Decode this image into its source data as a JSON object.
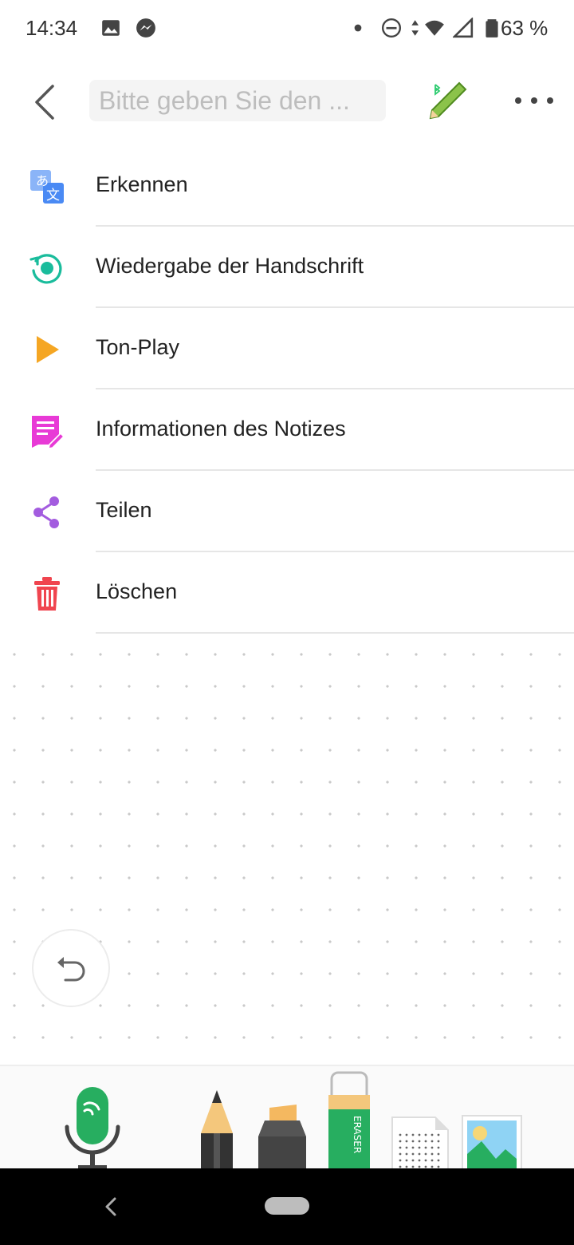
{
  "status_bar": {
    "time": "14:34",
    "battery": "63 %",
    "icons": [
      "image-icon",
      "messenger-icon",
      "dot-icon",
      "dnd-icon",
      "data-arrows-icon",
      "wifi-icon",
      "signal-icon",
      "battery-icon"
    ]
  },
  "appbar": {
    "search_placeholder": "Bitte geben Sie den ..."
  },
  "menu": {
    "items": [
      {
        "label": "Erkennen",
        "icon": "translate-icon",
        "color": "#4a8af4"
      },
      {
        "label": "Wiedergabe der Handschrift",
        "icon": "replay-icon",
        "color": "#1abc9c"
      },
      {
        "label": "Ton-Play",
        "icon": "play-icon",
        "color": "#f5a623"
      },
      {
        "label": "Informationen des Notizes",
        "icon": "note-info-icon",
        "color": "#e83ad6"
      },
      {
        "label": "Teilen",
        "icon": "share-icon",
        "color": "#a35cdf"
      },
      {
        "label": "Löschen",
        "icon": "trash-icon",
        "color": "#f0454f"
      }
    ]
  },
  "toolbar": {
    "tools": [
      "microphone-tool",
      "pencil-tool",
      "marker-tool",
      "eraser-tool",
      "paper-tool",
      "image-tool"
    ],
    "eraser_text": "ERASER"
  }
}
